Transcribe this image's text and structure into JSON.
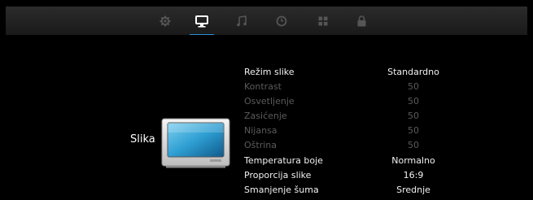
{
  "tabs": [
    {
      "name": "gear-icon",
      "active": false
    },
    {
      "name": "monitor-icon",
      "active": true
    },
    {
      "name": "music-note-icon",
      "active": false
    },
    {
      "name": "clock-icon",
      "active": false
    },
    {
      "name": "grid-icon",
      "active": false
    },
    {
      "name": "lock-icon",
      "active": false
    }
  ],
  "category": {
    "label": "Slika"
  },
  "settings": [
    {
      "label": "Režim slike",
      "value": "Standardno",
      "enabled": true
    },
    {
      "label": "Kontrast",
      "value": "50",
      "enabled": false
    },
    {
      "label": "Osvetljenje",
      "value": "50",
      "enabled": false
    },
    {
      "label": "Zasićenje",
      "value": "50",
      "enabled": false
    },
    {
      "label": "Nijansa",
      "value": "50",
      "enabled": false
    },
    {
      "label": "Oštrina",
      "value": "50",
      "enabled": false
    },
    {
      "label": "Temperatura boje",
      "value": "Normalno",
      "enabled": true
    },
    {
      "label": "Proporcija slike",
      "value": "16:9",
      "enabled": true
    },
    {
      "label": "Smanjenje šuma",
      "value": "Srednje",
      "enabled": true
    }
  ],
  "colors": {
    "accent": "#2a8fd8",
    "disabled_text": "#5b5b5b",
    "enabled_text": "#f2f2f2"
  }
}
